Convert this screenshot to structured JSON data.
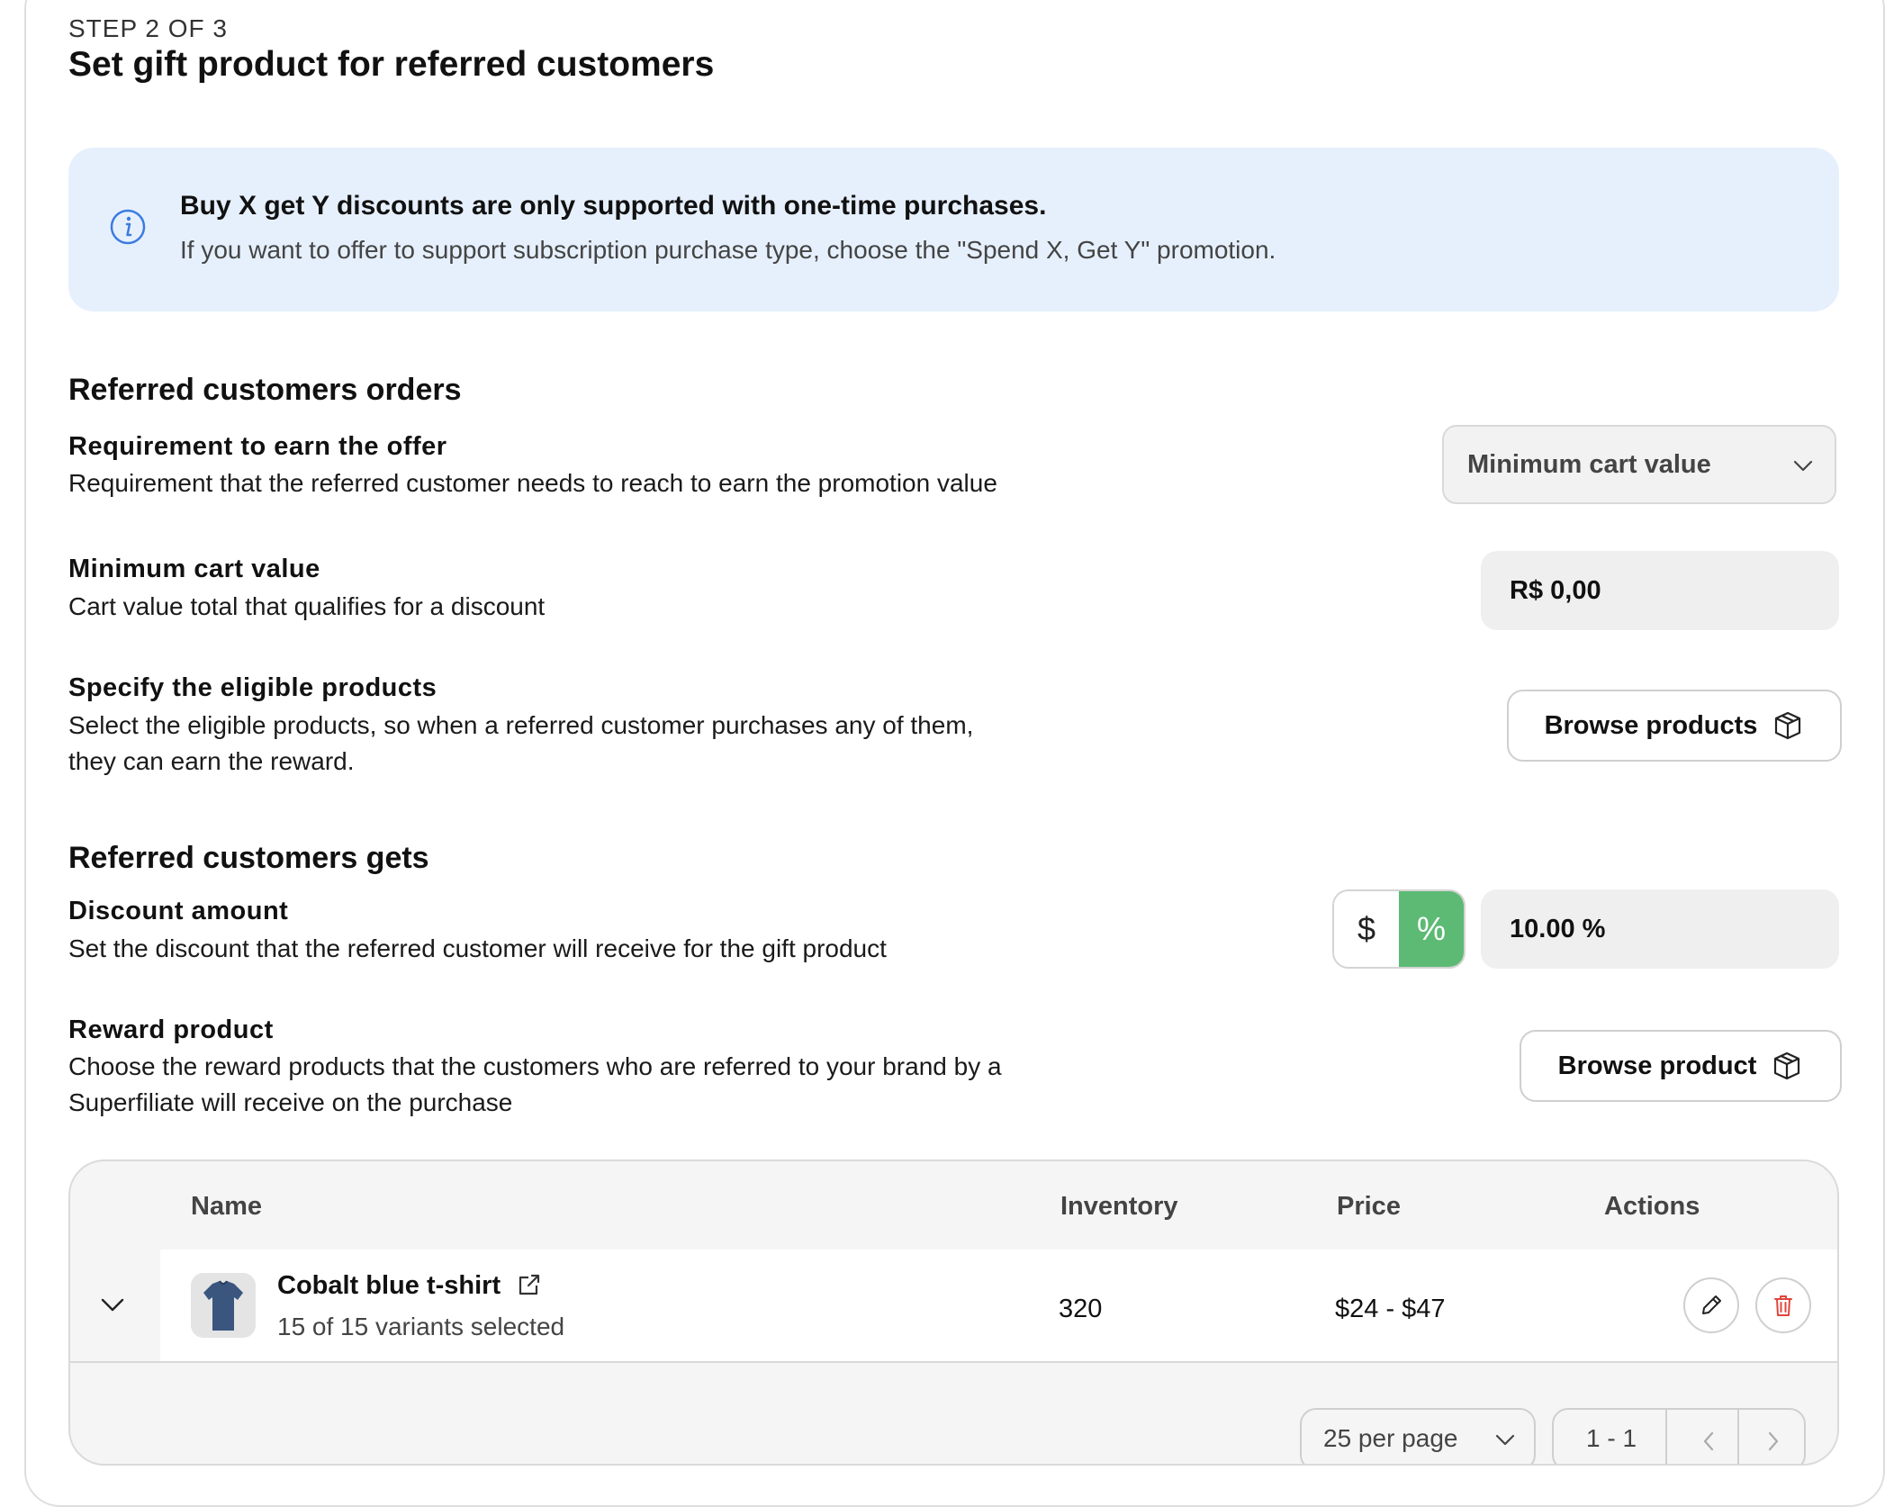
{
  "header": {
    "step": "STEP 2 OF 3",
    "title": "Set gift product for referred customers"
  },
  "banner": {
    "title": "Buy X get Y discounts are only supported with one-time purchases.",
    "text": "If you want to offer to support subscription purchase type, choose the \"Spend X, Get Y\" promotion."
  },
  "orders": {
    "heading": "Referred customers orders",
    "requirement": {
      "label": "Requirement to earn the offer",
      "desc": "Requirement that the referred customer needs to reach to earn the promotion value",
      "selected": "Minimum cart value"
    },
    "min_cart": {
      "label": "Minimum cart value",
      "desc": "Cart value total that qualifies for a discount",
      "value": "R$ 0,00"
    },
    "eligible": {
      "label": "Specify the eligible products",
      "desc": "Select the eligible products, so when a referred customer purchases any of them, they can earn the reward.",
      "button": "Browse products"
    }
  },
  "gets": {
    "heading": "Referred customers gets",
    "discount": {
      "label": "Discount amount",
      "desc": "Set the discount that the referred customer will receive for the gift product",
      "toggle_dollar": "$",
      "toggle_percent": "%",
      "value": "10.00 %"
    },
    "reward": {
      "label": "Reward product",
      "desc": "Choose the reward products that the customers who are referred to your brand by a Superfiliate will receive on the purchase",
      "button": "Browse product"
    }
  },
  "table": {
    "columns": [
      "Name",
      "Inventory",
      "Price",
      "Actions"
    ],
    "rows": [
      {
        "name": "Cobalt blue t-shirt",
        "variants": "15 of 15 variants selected",
        "inventory": "320",
        "price": "$24 - $47"
      }
    ],
    "pager": {
      "per_page": "25 per page",
      "range": "1 - 1"
    }
  },
  "colors": {
    "banner_bg": "#e6f0fd",
    "info_icon": "#3b7be0",
    "toggle_active": "#5dba74",
    "delete": "#e0453a"
  }
}
